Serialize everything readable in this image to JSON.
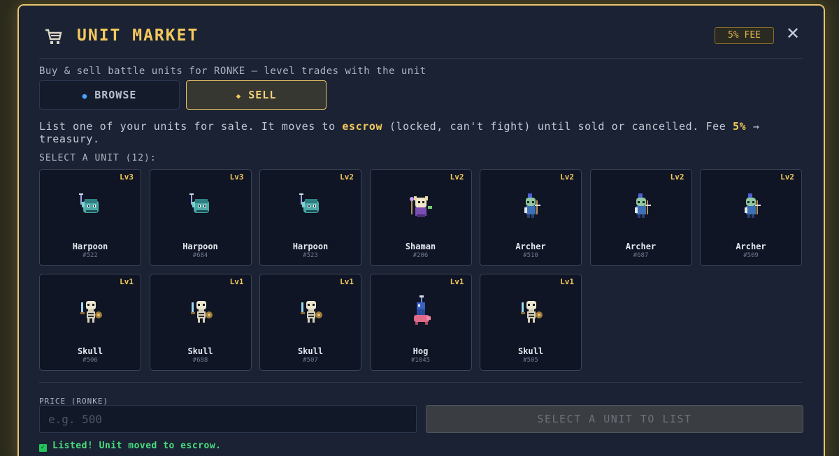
{
  "header": {
    "title": "UNIT MARKET",
    "fee_badge": "5% FEE",
    "close_label": "✕"
  },
  "subtitle": "Buy & sell battle units for RONKE — level trades with the unit",
  "tabs": {
    "browse": "BROWSE",
    "sell": "SELL",
    "active": "sell"
  },
  "description": {
    "part1": "List one of your units for sale. It moves to ",
    "highlight1": "escrow",
    "part2": " (locked, can't fight) until sold or cancelled. Fee ",
    "highlight2": "5%",
    "part3": " → treasury."
  },
  "select_label": "SELECT A UNIT (12):",
  "units": [
    {
      "level": "Lv3",
      "name": "Harpoon",
      "id": "#522",
      "sprite": "harpoon-sprite"
    },
    {
      "level": "Lv3",
      "name": "Harpoon",
      "id": "#684",
      "sprite": "harpoon-sprite"
    },
    {
      "level": "Lv2",
      "name": "Harpoon",
      "id": "#523",
      "sprite": "harpoon-sprite"
    },
    {
      "level": "Lv2",
      "name": "Shaman",
      "id": "#206",
      "sprite": "shaman-sprite"
    },
    {
      "level": "Lv2",
      "name": "Archer",
      "id": "#510",
      "sprite": "archer-sprite"
    },
    {
      "level": "Lv2",
      "name": "Archer",
      "id": "#687",
      "sprite": "archer-sprite"
    },
    {
      "level": "Lv2",
      "name": "Archer",
      "id": "#509",
      "sprite": "archer-sprite"
    },
    {
      "level": "Lv1",
      "name": "Skull",
      "id": "#506",
      "sprite": "skull-sprite"
    },
    {
      "level": "Lv1",
      "name": "Skull",
      "id": "#688",
      "sprite": "skull-sprite"
    },
    {
      "level": "Lv1",
      "name": "Skull",
      "id": "#507",
      "sprite": "skull-sprite"
    },
    {
      "level": "Lv1",
      "name": "Hog",
      "id": "#1045",
      "sprite": "hog-sprite"
    },
    {
      "level": "Lv1",
      "name": "Skull",
      "id": "#505",
      "sprite": "skull-sprite"
    }
  ],
  "price": {
    "label": "PRICE (RONKE)",
    "placeholder": "e.g. 500",
    "value": ""
  },
  "list_button": "SELECT A UNIT TO LIST",
  "status": "Listed! Unit moved to escrow.",
  "colors": {
    "accent": "#f4c95d",
    "background": "#1a2233",
    "success": "#4ade80"
  }
}
